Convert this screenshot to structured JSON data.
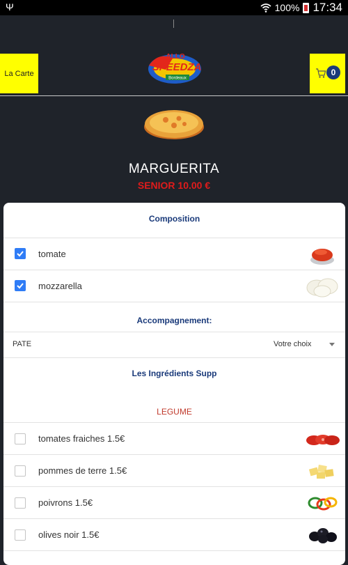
{
  "status": {
    "battery": "100%",
    "time": "17:34"
  },
  "header": {
    "carte_label": "La Carte",
    "cart_count": "0"
  },
  "product": {
    "name": "MARGUERITA",
    "price": "SENIOR 10.00 €"
  },
  "composition": {
    "title": "Composition",
    "items": [
      {
        "label": "tomate",
        "checked": true
      },
      {
        "label": "mozzarella",
        "checked": true
      }
    ]
  },
  "accompagnement": {
    "title": "Accompagnement:",
    "field_label": "PATE",
    "select_value": "Votre choix"
  },
  "supplements": {
    "title": "Les Ingrédients Supp",
    "category": "LEGUME",
    "items": [
      {
        "label": "tomates fraiches 1.5€",
        "checked": false
      },
      {
        "label": "pommes de terre 1.5€",
        "checked": false
      },
      {
        "label": "poivrons 1.5€",
        "checked": false
      },
      {
        "label": "olives noir 1.5€",
        "checked": false
      }
    ]
  },
  "colors": {
    "accent_yellow": "#ffff00",
    "navy": "#1a3a7a",
    "price_red": "#e01b1b",
    "checkbox_blue": "#2f7cf6"
  }
}
